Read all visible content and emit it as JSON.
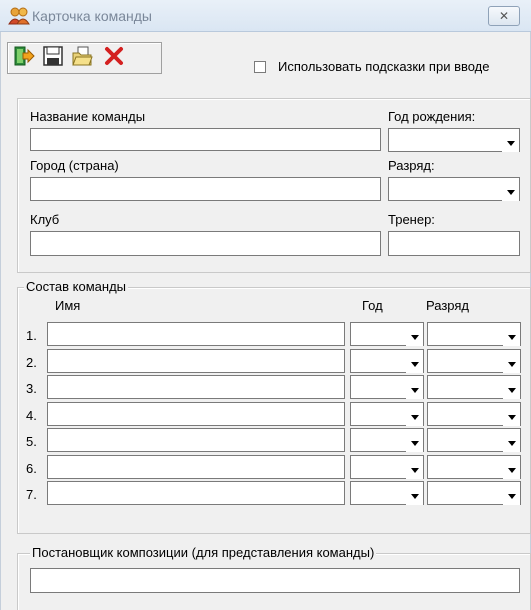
{
  "window": {
    "title": "Карточка команды",
    "close_glyph": "✕",
    "icons": [
      "team-icon",
      "exit-icon",
      "save-icon",
      "open-folder-icon",
      "delete-icon"
    ]
  },
  "toolbar": {
    "hints_checkbox_label": "Использовать подсказки при вводе",
    "hints_checked": false
  },
  "team": {
    "name_label": "Название команды",
    "name_value": "",
    "year_label": "Год рождения:",
    "year_value": "",
    "city_label": "Город (страна)",
    "city_value": "",
    "rank_label": "Разряд:",
    "rank_value": "",
    "club_label": "Клуб",
    "club_value": "",
    "coach_label": "Тренер:",
    "coach_value": ""
  },
  "roster": {
    "group_title": "Состав команды",
    "col_name": "Имя",
    "col_year": "Год",
    "col_rank": "Разряд",
    "rows": [
      {
        "num": "1.",
        "name": "",
        "year": "",
        "rank": ""
      },
      {
        "num": "2.",
        "name": "",
        "year": "",
        "rank": ""
      },
      {
        "num": "3.",
        "name": "",
        "year": "",
        "rank": ""
      },
      {
        "num": "4.",
        "name": "",
        "year": "",
        "rank": ""
      },
      {
        "num": "5.",
        "name": "",
        "year": "",
        "rank": ""
      },
      {
        "num": "6.",
        "name": "",
        "year": "",
        "rank": ""
      },
      {
        "num": "7.",
        "name": "",
        "year": "",
        "rank": ""
      }
    ]
  },
  "composer": {
    "group_title": "Постановщик композиции (для представления команды)",
    "value": ""
  }
}
